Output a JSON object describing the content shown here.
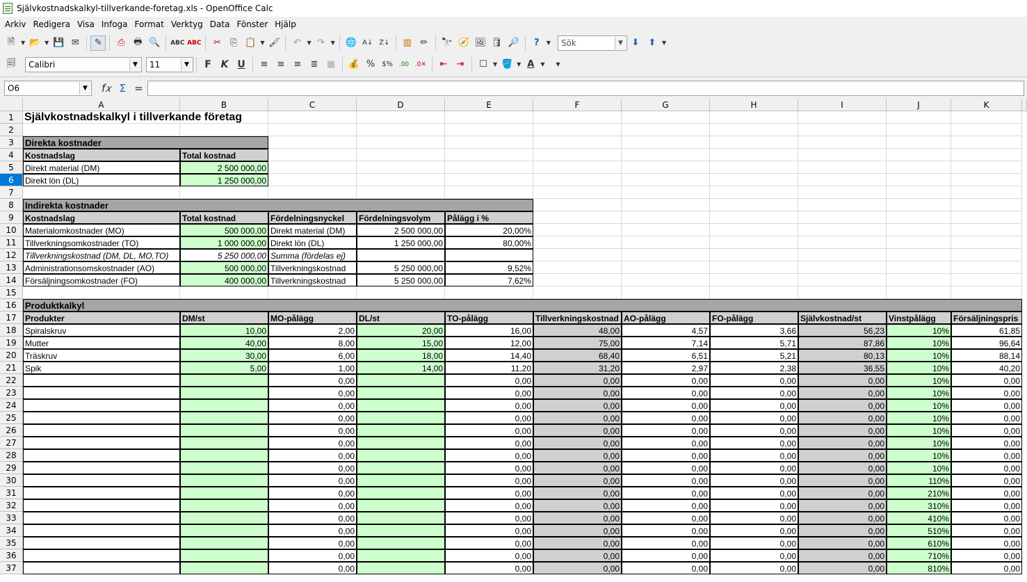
{
  "window": {
    "title": "Självkostnadskalkyl-tillverkande-foretag.xls - OpenOffice Calc"
  },
  "menu": [
    "Arkiv",
    "Redigera",
    "Visa",
    "Infoga",
    "Format",
    "Verktyg",
    "Data",
    "Fönster",
    "Hjälp"
  ],
  "toolbar": {
    "search_placeholder": "Sök",
    "font_name": "Calibri",
    "font_size": "11",
    "bold_label": "F",
    "italic_label": "K",
    "underline_label": "U"
  },
  "formula_bar": {
    "cell_ref": "O6",
    "content": ""
  },
  "sheet": {
    "columns": [
      "A",
      "B",
      "C",
      "D",
      "E",
      "F",
      "G",
      "H",
      "I",
      "J",
      "K"
    ],
    "selected_row": 6,
    "title": "Självkostnadskalkyl i tillverkande företag",
    "direct": {
      "section": "Direkta kostnader",
      "header": [
        "Kostnadslag",
        "Total kostnad"
      ],
      "rows": [
        [
          "Direkt material (DM)",
          "2 500 000,00"
        ],
        [
          "Direkt lön (DL)",
          "1 250 000,00"
        ]
      ]
    },
    "indirect": {
      "section": "Indirekta kostnader",
      "header": [
        "Kostnadslag",
        "Total kostnad",
        "Fördelningsnyckel",
        "Fördelningsvolym",
        "Pålägg i %"
      ],
      "rows": [
        [
          "Materialomkostnader (MO)",
          "500 000,00",
          "Direkt material (DM)",
          "2 500 000,00",
          "20,00%"
        ],
        [
          "Tillverkningsomkostnader (TO)",
          "1 000 000,00",
          "Direkt lön (DL)",
          "1 250 000,00",
          "80,00%"
        ],
        [
          "Tillverkningskostnad (DM, DL, MO,TO)",
          "5 250 000,00",
          "Summa (fördelas ej)",
          "",
          ""
        ],
        [
          "Administrationsomskostnader (AO)",
          "500 000,00",
          "Tillverkningskostnad",
          "5 250 000,00",
          "9,52%"
        ],
        [
          "Försäljningsomkostnader (FO)",
          "400 000,00",
          "Tillverkningskostnad",
          "5 250 000,00",
          "7,62%"
        ]
      ]
    },
    "product": {
      "section": "Produktkalkyl",
      "header": [
        "Produkter",
        "DM/st",
        "MO-pålägg",
        "DL/st",
        "TO-pålägg",
        "Tillverkningskostnad",
        "AO-pålägg",
        "FO-pålägg",
        "Självkostnad/st",
        "Vinstpålägg",
        "Försäljningspris"
      ],
      "rows": [
        [
          "Spiralskruv",
          "10,00",
          "2,00",
          "20,00",
          "16,00",
          "48,00",
          "4,57",
          "3,66",
          "56,23",
          "10%",
          "61,85"
        ],
        [
          "Mutter",
          "40,00",
          "8,00",
          "15,00",
          "12,00",
          "75,00",
          "7,14",
          "5,71",
          "87,86",
          "10%",
          "96,64"
        ],
        [
          "Träskruv",
          "30,00",
          "6,00",
          "18,00",
          "14,40",
          "68,40",
          "6,51",
          "5,21",
          "80,13",
          "10%",
          "88,14"
        ],
        [
          "Spik",
          "5,00",
          "1,00",
          "14,00",
          "11,20",
          "31,20",
          "2,97",
          "2,38",
          "36,55",
          "10%",
          "40,20"
        ],
        [
          "",
          "",
          "0,00",
          "",
          "0,00",
          "0,00",
          "0,00",
          "0,00",
          "0,00",
          "10%",
          "0,00"
        ],
        [
          "",
          "",
          "0,00",
          "",
          "0,00",
          "0,00",
          "0,00",
          "0,00",
          "0,00",
          "10%",
          "0,00"
        ],
        [
          "",
          "",
          "0,00",
          "",
          "0,00",
          "0,00",
          "0,00",
          "0,00",
          "0,00",
          "10%",
          "0,00"
        ],
        [
          "",
          "",
          "0,00",
          "",
          "0,00",
          "0,00",
          "0,00",
          "0,00",
          "0,00",
          "10%",
          "0,00"
        ],
        [
          "",
          "",
          "0,00",
          "",
          "0,00",
          "0,00",
          "0,00",
          "0,00",
          "0,00",
          "10%",
          "0,00"
        ],
        [
          "",
          "",
          "0,00",
          "",
          "0,00",
          "0,00",
          "0,00",
          "0,00",
          "0,00",
          "10%",
          "0,00"
        ],
        [
          "",
          "",
          "0,00",
          "",
          "0,00",
          "0,00",
          "0,00",
          "0,00",
          "0,00",
          "10%",
          "0,00"
        ],
        [
          "",
          "",
          "0,00",
          "",
          "0,00",
          "0,00",
          "0,00",
          "0,00",
          "0,00",
          "10%",
          "0,00"
        ],
        [
          "",
          "",
          "0,00",
          "",
          "0,00",
          "0,00",
          "0,00",
          "0,00",
          "0,00",
          "110%",
          "0,00"
        ],
        [
          "",
          "",
          "0,00",
          "",
          "0,00",
          "0,00",
          "0,00",
          "0,00",
          "0,00",
          "210%",
          "0,00"
        ],
        [
          "",
          "",
          "0,00",
          "",
          "0,00",
          "0,00",
          "0,00",
          "0,00",
          "0,00",
          "310%",
          "0,00"
        ],
        [
          "",
          "",
          "0,00",
          "",
          "0,00",
          "0,00",
          "0,00",
          "0,00",
          "0,00",
          "410%",
          "0,00"
        ],
        [
          "",
          "",
          "0,00",
          "",
          "0,00",
          "0,00",
          "0,00",
          "0,00",
          "0,00",
          "510%",
          "0,00"
        ],
        [
          "",
          "",
          "0,00",
          "",
          "0,00",
          "0,00",
          "0,00",
          "0,00",
          "0,00",
          "610%",
          "0,00"
        ],
        [
          "",
          "",
          "0,00",
          "",
          "0,00",
          "0,00",
          "0,00",
          "0,00",
          "0,00",
          "710%",
          "0,00"
        ],
        [
          "",
          "",
          "0,00",
          "",
          "0,00",
          "0,00",
          "0,00",
          "0,00",
          "0,00",
          "810%",
          "0,00"
        ]
      ]
    }
  }
}
